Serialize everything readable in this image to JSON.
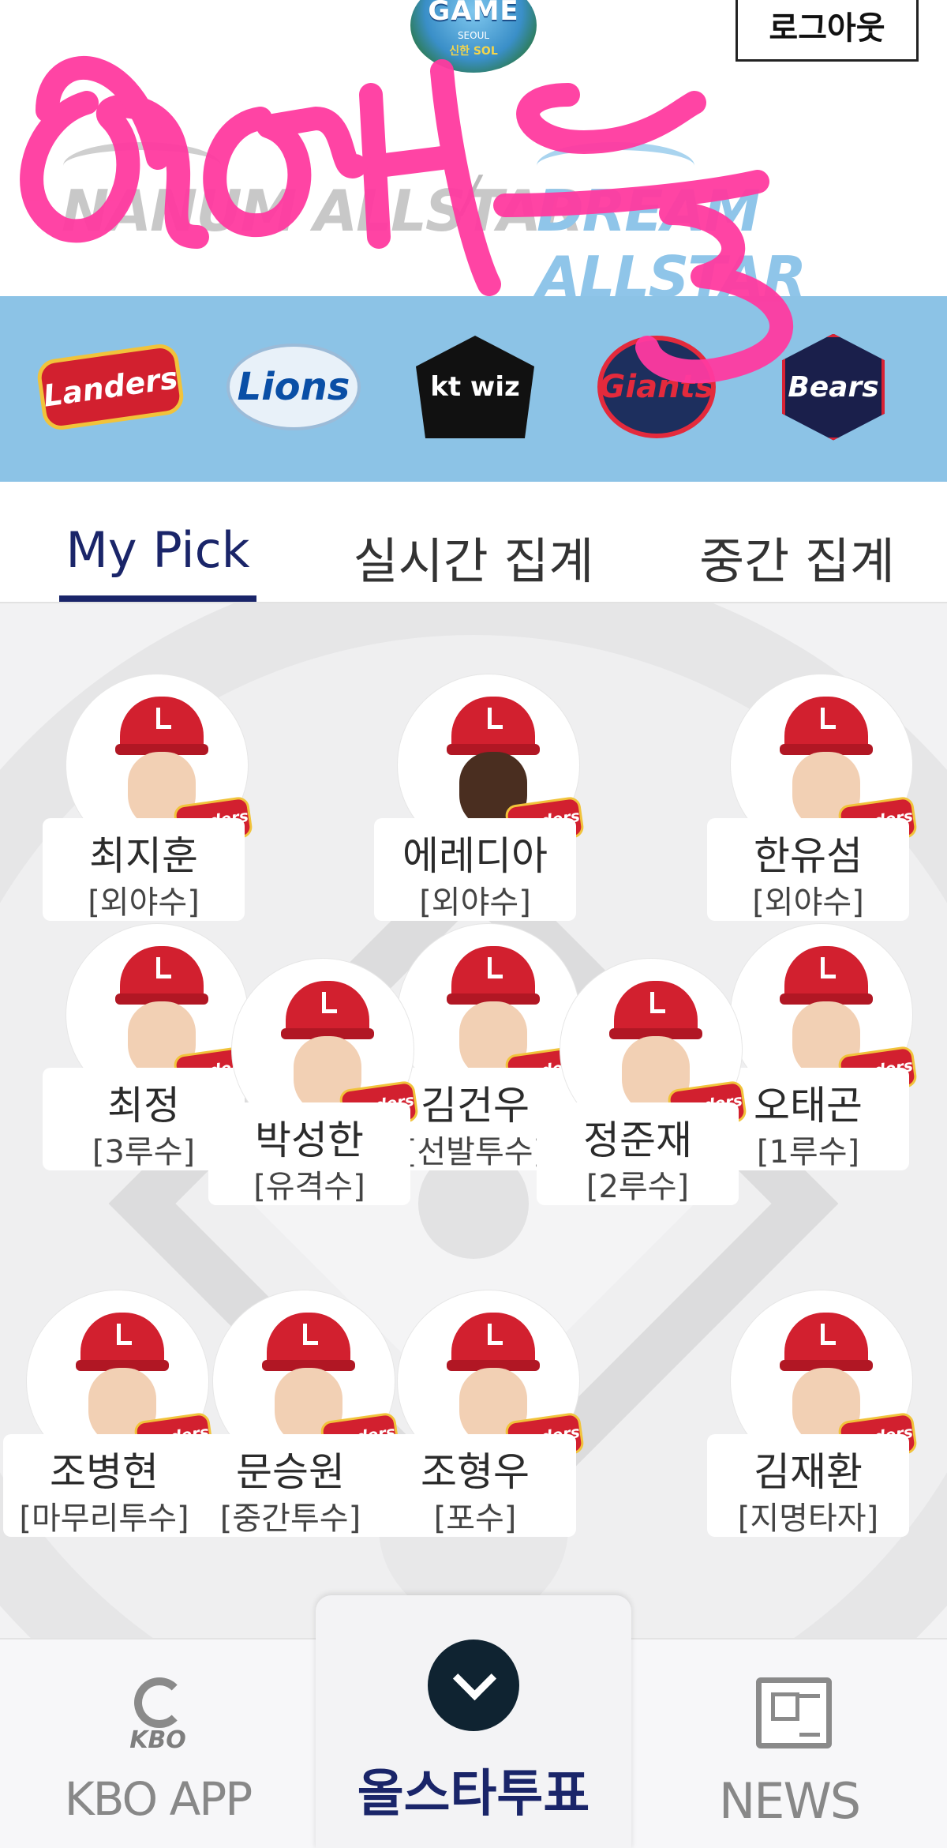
{
  "header": {
    "event_logo_text": "GAME",
    "event_logo_sub": "SEOUL",
    "event_logo_sponsor": "신한 SOL",
    "logout_label": "로그아웃",
    "nanum_title": "NANUM ALLSTAR",
    "dream_title": "DREAM ALLSTAR",
    "slash": "/"
  },
  "teams": [
    "Landers",
    "Lions",
    "kt wiz",
    "Giants",
    "Bears"
  ],
  "tabs": {
    "my_pick": "My Pick",
    "realtime": "실시간 집계",
    "interim": "중간 집계"
  },
  "team_badge_mini": "Landers",
  "players": [
    {
      "name": "최지훈",
      "position": "[외야수]"
    },
    {
      "name": "에레디아",
      "position": "[외야수]"
    },
    {
      "name": "한유섬",
      "position": "[외야수]"
    },
    {
      "name": "최정",
      "position": "[3루수]"
    },
    {
      "name": "박성한",
      "position": "[유격수]"
    },
    {
      "name": "김건우",
      "position": "[선발투수]"
    },
    {
      "name": "정준재",
      "position": "[2루수]"
    },
    {
      "name": "오태곤",
      "position": "[1루수]"
    },
    {
      "name": "조병현",
      "position": "[마무리투수]"
    },
    {
      "name": "문승원",
      "position": "[중간투수]"
    },
    {
      "name": "조형우",
      "position": "[포수]"
    },
    {
      "name": "김재환",
      "position": "[지명타자]"
    }
  ],
  "bottom_nav": {
    "kbo_mark": "KBO",
    "kbo_app_label": "KBO APP",
    "vote_label": "올스타투표",
    "news_label": "NEWS"
  },
  "colors": {
    "accent": "#1a2569",
    "team_strip": "#8cc3e6",
    "landers_red": "#d2202f",
    "doodle_pink": "#ff3aa0"
  }
}
